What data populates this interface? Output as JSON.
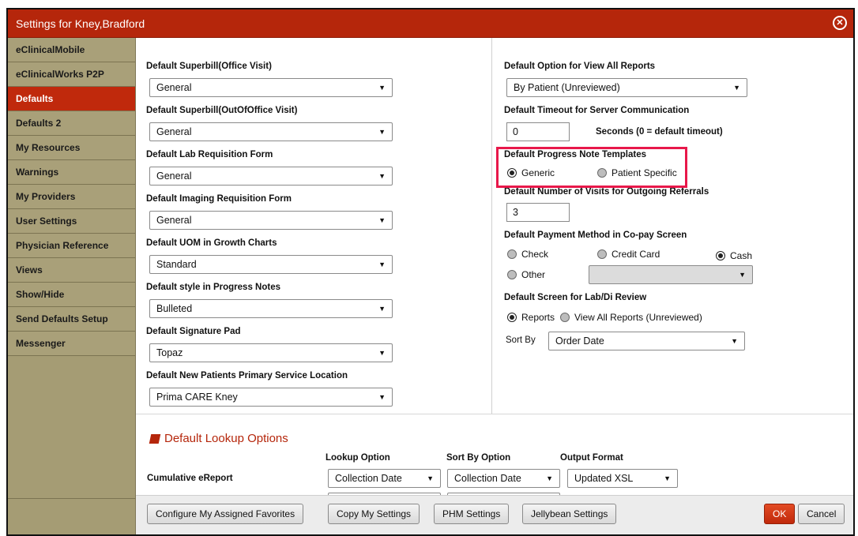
{
  "window": {
    "title": "Settings for Kney,Bradford",
    "close_glyph": "⊗"
  },
  "sidebar": {
    "items": [
      {
        "label": "eClinicalMobile"
      },
      {
        "label": "eClinicalWorks P2P"
      },
      {
        "label": "Defaults",
        "active": true
      },
      {
        "label": "Defaults 2"
      },
      {
        "label": "My Resources"
      },
      {
        "label": "Warnings"
      },
      {
        "label": "My Providers"
      },
      {
        "label": "User Settings"
      },
      {
        "label": "Physician Reference"
      },
      {
        "label": "Views"
      },
      {
        "label": "Show/Hide"
      },
      {
        "label": "Send Defaults Setup"
      },
      {
        "label": "Messenger"
      }
    ]
  },
  "left": {
    "superbill_office_label": "Default Superbill(Office Visit)",
    "superbill_office_value": "General",
    "superbill_outoffice_label": "Default Superbill(OutOfOffice Visit)",
    "superbill_outoffice_value": "General",
    "lab_req_label": "Default Lab Requisition Form",
    "lab_req_value": "General",
    "imaging_req_label": "Default Imaging Requisition Form",
    "imaging_req_value": "General",
    "uom_label": "Default UOM in Growth Charts",
    "uom_value": "Standard",
    "style_label": "Default style in Progress Notes",
    "style_value": "Bulleted",
    "sigpad_label": "Default Signature Pad",
    "sigpad_value": "Topaz",
    "location_label": "Default New Patients Primary Service Location",
    "location_value": "Prima CARE Kney"
  },
  "right": {
    "view_reports_label": "Default Option for View All Reports",
    "view_reports_value": "By Patient (Unreviewed)",
    "timeout_label": "Default Timeout for Server Communication",
    "timeout_value": "0",
    "timeout_hint": "Seconds (0 = default timeout)",
    "pn_templates_label": "Default Progress Note Templates",
    "pn_generic": "Generic",
    "pn_patient_specific": "Patient Specific",
    "visits_label": "Default Number of Visits for Outgoing Referrals",
    "visits_value": "3",
    "payment_label": "Default Payment Method in Co-pay Screen",
    "pay_check": "Check",
    "pay_credit": "Credit Card",
    "pay_cash": "Cash",
    "pay_other": "Other",
    "pay_other_value": "",
    "labdi_label": "Default Screen for Lab/Di Review",
    "labdi_reports": "Reports",
    "labdi_view_all": "View All Reports (Unreviewed)",
    "sortby_label": "Sort By",
    "sortby_value": "Order Date"
  },
  "lookup": {
    "heading": "Default Lookup Options",
    "col_lookup": "Lookup Option",
    "col_sort": "Sort By Option",
    "col_output": "Output Format",
    "row_label": "Cumulative eReport",
    "row_lookup": "Collection Date",
    "row_sort": "Collection Date",
    "row_output": "Updated XSL"
  },
  "footer": {
    "configure": "Configure My Assigned Favorites",
    "copy": "Copy My Settings",
    "phm": "PHM Settings",
    "jellybean": "Jellybean Settings",
    "ok": "OK",
    "cancel": "Cancel"
  },
  "icons": {
    "dropdown_arrow": "▼"
  },
  "colors": {
    "accent": "#b5260b",
    "highlight": "#e8184a",
    "sidebar": "#a59c74"
  }
}
